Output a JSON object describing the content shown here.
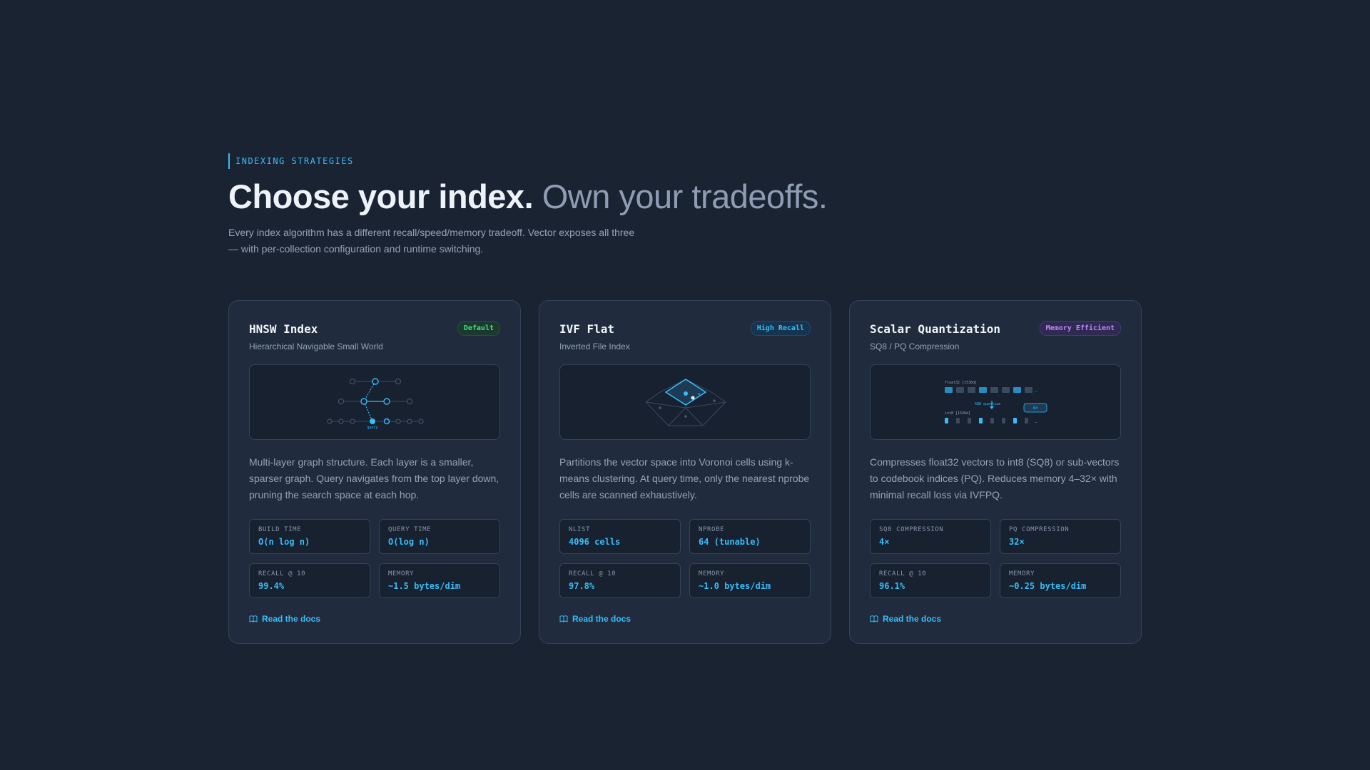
{
  "header": {
    "eyebrow": "INDEXING STRATEGIES",
    "title_strong": "Choose your index.",
    "title_soft": "Own your tradeoffs.",
    "subtitle": "Every index algorithm has a different recall/speed/memory tradeoff. Vector exposes all three — with per-collection configuration and runtime switching."
  },
  "colors": {
    "background": "#1a2332",
    "card": "#202c3e",
    "accent": "#38bdf8",
    "badge_green": "#4ade80",
    "badge_blue": "#38bdf8",
    "badge_purple": "#c084fc"
  },
  "cards": [
    {
      "title": "HNSW Index",
      "badge": "Default",
      "subtitle": "Hierarchical Navigable Small World",
      "viz_label": "query",
      "description": "Multi-layer graph structure. Each layer is a smaller, sparser graph. Query navigates from the top layer down, pruning the search space at each hop.",
      "stats": [
        {
          "label": "BUILD TIME",
          "value": "O(n log n)"
        },
        {
          "label": "QUERY TIME",
          "value": "O(log n)"
        },
        {
          "label": "RECALL @ 10",
          "value": "99.4%"
        },
        {
          "label": "MEMORY",
          "value": "~1.5 bytes/dim"
        }
      ],
      "link": "Read the docs",
      "link_icon": "book-icon"
    },
    {
      "title": "IVF Flat",
      "badge": "High Recall",
      "subtitle": "Inverted File Index",
      "viz_label": "q",
      "description": "Partitions the vector space into Voronoi cells using k-means clustering. At query time, only the nearest nprobe cells are scanned exhaustively.",
      "stats": [
        {
          "label": "NLIST",
          "value": "4096 cells"
        },
        {
          "label": "NPROBE",
          "value": "64 (tunable)"
        },
        {
          "label": "RECALL @ 10",
          "value": "97.8%"
        },
        {
          "label": "MEMORY",
          "value": "~1.0 bytes/dim"
        }
      ],
      "link": "Read the docs",
      "link_icon": "book-icon"
    },
    {
      "title": "Scalar Quantization",
      "badge": "Memory Efficient",
      "subtitle": "SQ8 / PQ Compression",
      "viz_top_label": "float32 [1536d]",
      "viz_mid_label": "SQ8 quantize",
      "viz_ratio": "4×",
      "viz_bottom_label": "int8 [1536d]",
      "description": "Compresses float32 vectors to int8 (SQ8) or sub-vectors to codebook indices (PQ). Reduces memory 4–32× with minimal recall loss via IVFPQ.",
      "stats": [
        {
          "label": "SQ8 COMPRESSION",
          "value": "4×"
        },
        {
          "label": "PQ COMPRESSION",
          "value": "32×"
        },
        {
          "label": "RECALL @ 10",
          "value": "96.1%"
        },
        {
          "label": "MEMORY",
          "value": "~0.25 bytes/dim"
        }
      ],
      "link": "Read the docs",
      "link_icon": "book-icon"
    }
  ]
}
